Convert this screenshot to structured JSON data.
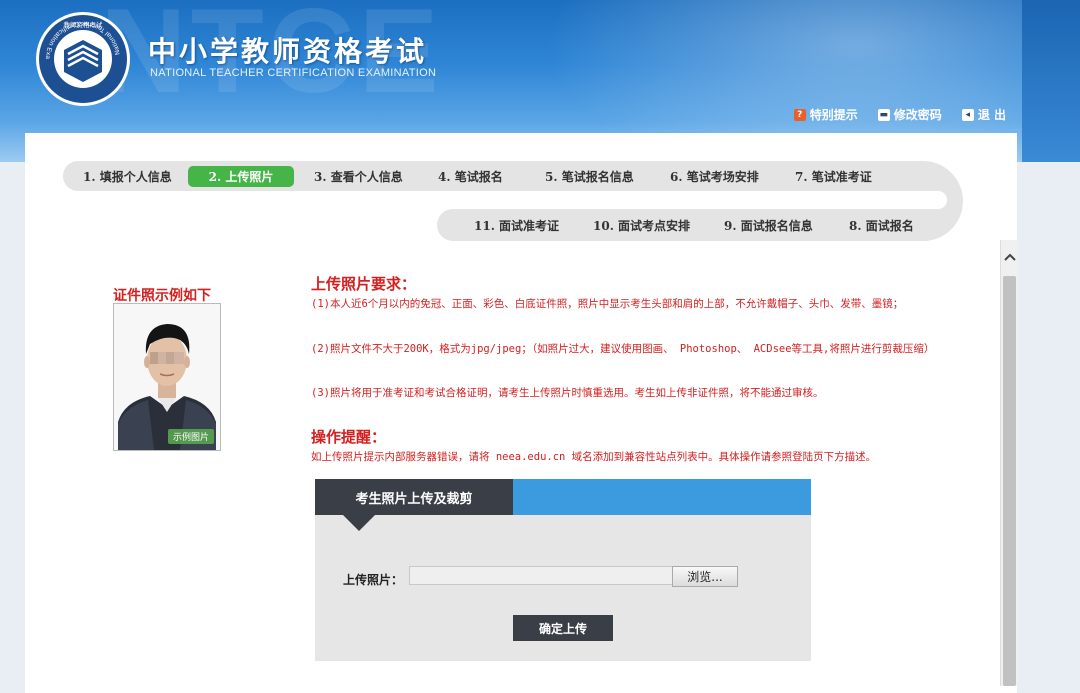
{
  "header": {
    "watermark": "NTCE",
    "title": "中小学教师资格考试",
    "subtitle": "NATIONAL TEACHER CERTIFICATION EXAMINATION",
    "logo_ring_text": "National Teacher Certification Examination",
    "logo_top_text": "教师资格考试",
    "links": [
      {
        "icon": "question-icon",
        "label": "特别提示"
      },
      {
        "icon": "key-icon",
        "label": "修改密码"
      },
      {
        "icon": "logout-icon",
        "label": "退 出"
      }
    ]
  },
  "steps_row1": [
    {
      "label": "1. 填报个人信息",
      "active": false
    },
    {
      "label": "2. 上传照片",
      "active": true
    },
    {
      "label": "3. 查看个人信息",
      "active": false
    },
    {
      "label": "4. 笔试报名",
      "active": false
    },
    {
      "label": "5. 笔试报名信息",
      "active": false
    },
    {
      "label": "6. 笔试考场安排",
      "active": false
    },
    {
      "label": "7. 笔试准考证",
      "active": false
    }
  ],
  "steps_row2": [
    {
      "label": "11. 面试准考证"
    },
    {
      "label": "10. 面试考点安排"
    },
    {
      "label": "9. 面试报名信息"
    },
    {
      "label": "8. 面试报名"
    }
  ],
  "sample": {
    "title": "证件照示例如下",
    "badge": "示例图片"
  },
  "requirements": {
    "title": "上传照片要求：",
    "items": [
      "(1)本人近6个月以内的免冠、正面、彩色、白底证件照，照片中显示考生头部和肩的上部，不允许戴帽子、头巾、发带、墨镜；",
      "(2)照片文件不大于200K，格式为jpg/jpeg；（如照片过大，建议使用图画、 Photoshop、 ACDsee等工具,将照片进行剪裁压缩）",
      "(3)照片将用于准考证和考试合格证明，请考生上传照片时慎重选用。考生如上传非证件照，将不能通过审核。"
    ]
  },
  "operations": {
    "title": "操作提醒：",
    "text": "如上传照片提示内部服务器错误，请将 neea.edu.cn 域名添加到兼容性站点列表中。具体操作请参照登陆页下方描述。"
  },
  "upload": {
    "tab_label": "考生照片上传及裁剪",
    "field_label": "上传照片：",
    "field_value": "",
    "browse_label": "浏览...",
    "confirm_label": "确定上传"
  },
  "colors": {
    "accent_red": "#d42020",
    "active_step": "#46b548",
    "upload_header": "#3c9ade",
    "dark_button": "#3a3f47"
  }
}
